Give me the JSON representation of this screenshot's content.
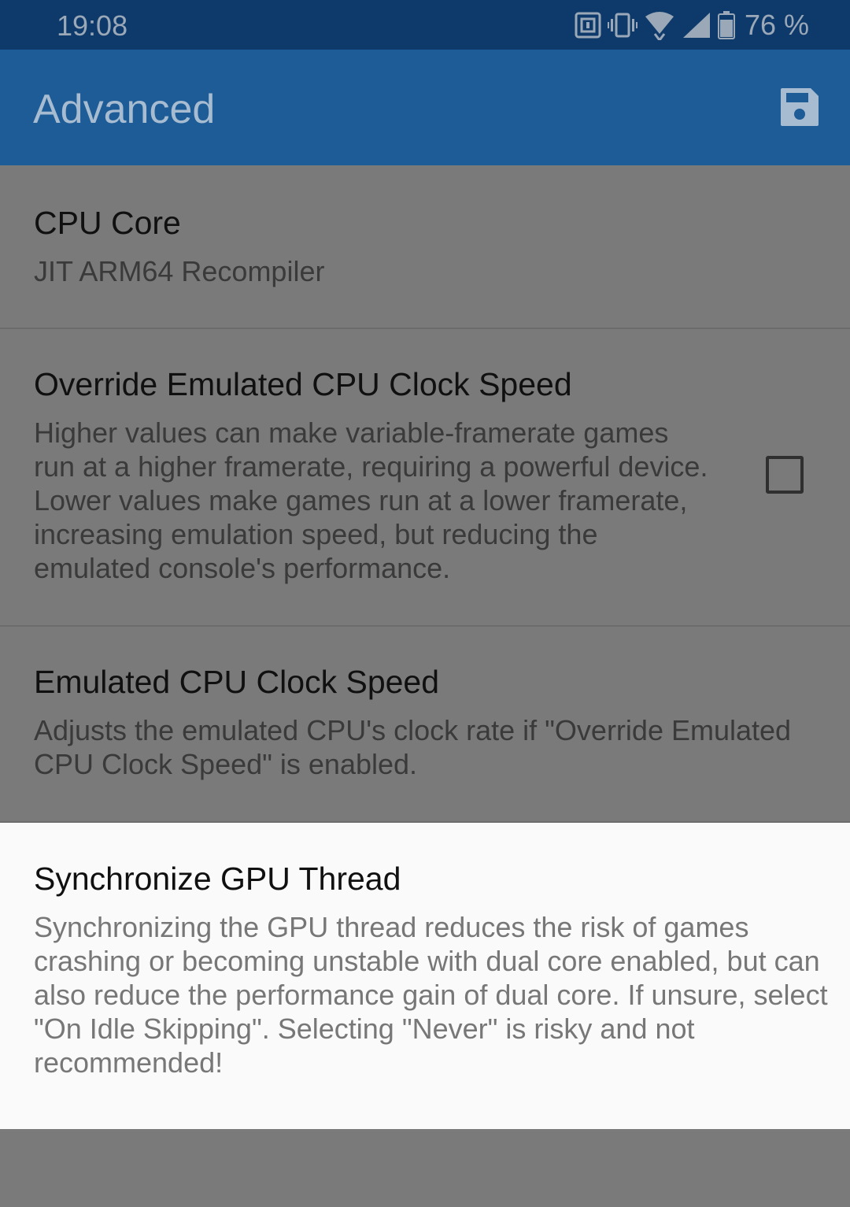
{
  "status_bar": {
    "time": "19:08",
    "battery_percent": "76 %",
    "icons": [
      "nfc-icon",
      "vibrate-icon",
      "wifi-icon",
      "cell-signal-icon",
      "battery-icon"
    ]
  },
  "app_bar": {
    "title": "Advanced",
    "action_icon": "save-icon"
  },
  "settings": {
    "cpu_core": {
      "title": "CPU Core",
      "value": "JIT ARM64 Recompiler"
    },
    "override_clock": {
      "title": "Override Emulated CPU Clock Speed",
      "description": "Higher values can make variable-framerate games run at a higher framerate, requiring a powerful device. Lower values make games run at a lower framerate, increasing emulation speed, but reducing the emulated console's performance.",
      "checked": false
    },
    "clock_speed": {
      "title": "Emulated CPU Clock Speed",
      "description": "Adjusts the emulated CPU's clock rate if \"Override Emulated CPU Clock Speed\" is enabled."
    },
    "sync_gpu": {
      "title": "Synchronize GPU Thread",
      "description": "Synchronizing the GPU thread reduces the risk of games crashing or becoming unstable with dual core enabled, but can also reduce the performance gain of dual core. If unsure, select \"On Idle Skipping\". Selecting \"Never\" is risky and not recommended!"
    }
  },
  "colors": {
    "status_bar": "#0e3a6b",
    "app_bar": "#1d5c97",
    "dim_overlay": "#7a7a7a",
    "highlight_item": "#fafafa"
  }
}
